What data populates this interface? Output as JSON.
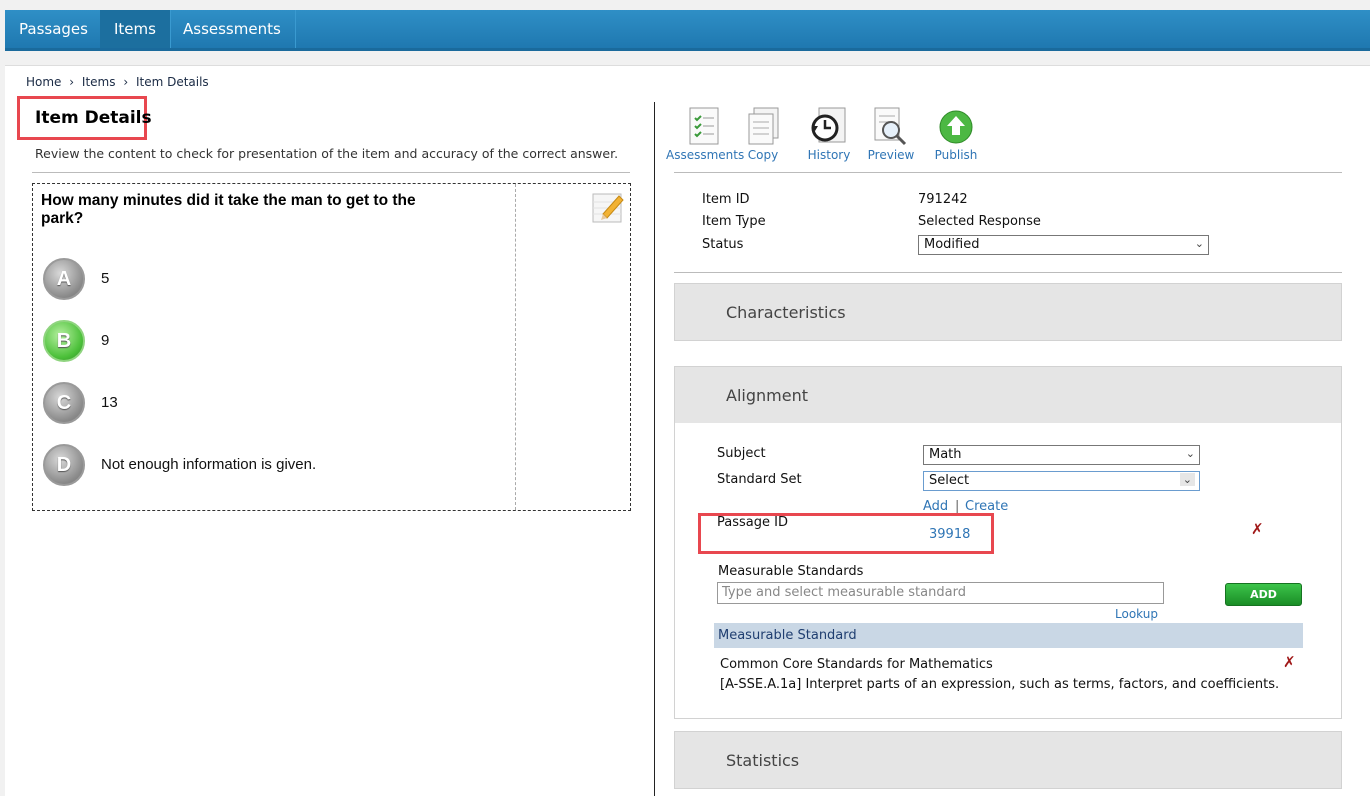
{
  "nav": {
    "passages": "Passages",
    "items": "Items",
    "assessments": "Assessments"
  },
  "breadcrumb": {
    "home": "Home",
    "sep1": "›",
    "items": "Items",
    "sep2": "›",
    "current": "Item Details"
  },
  "page": {
    "title": "Item Details",
    "subtitle": "Review the content to check for presentation of the item and accuracy of the correct answer."
  },
  "question": {
    "text": "How many minutes did it take the man to get to the park?",
    "options": [
      {
        "letter": "A",
        "text": "5",
        "correct": false
      },
      {
        "letter": "B",
        "text": "9",
        "correct": true
      },
      {
        "letter": "C",
        "text": "13",
        "correct": false
      },
      {
        "letter": "D",
        "text": "Not enough information is given.",
        "correct": false
      }
    ]
  },
  "toolbar": {
    "assessments": "Assessments",
    "copy": "Copy",
    "history": "History",
    "preview": "Preview",
    "publish": "Publish"
  },
  "meta": {
    "item_id_label": "Item ID",
    "item_id": "791242",
    "item_type_label": "Item Type",
    "item_type": "Selected Response",
    "status_label": "Status",
    "status": "Modified"
  },
  "sections": {
    "characteristics": "Characteristics",
    "alignment": "Alignment",
    "statistics": "Statistics"
  },
  "alignment": {
    "subject_label": "Subject",
    "subject": "Math",
    "standard_set_label": "Standard Set",
    "standard_set": "Select",
    "add_link": "Add",
    "link_sep": "|",
    "create_link": "Create",
    "passage_id_label": "Passage ID",
    "passage_id": "39918",
    "measurable_label": "Measurable Standards",
    "measurable_placeholder": "Type and select measurable standard",
    "lookup": "Lookup",
    "add_button": "ADD",
    "table_header": "Measurable Standard",
    "standard_title": "Common Core Standards for Mathematics",
    "standard_desc": "[A-SSE.A.1a] Interpret parts of an expression, such as terms, factors, and coefficients."
  },
  "colors": {
    "nav_bg": "#1f78b0",
    "highlight": "#e8474f",
    "link": "#2f75b5",
    "correct": "#4cc03a"
  }
}
